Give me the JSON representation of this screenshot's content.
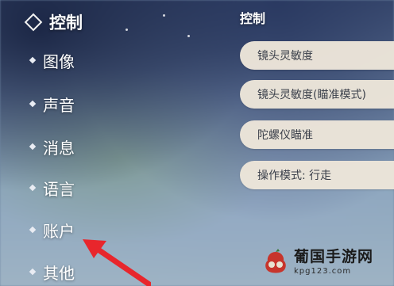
{
  "nav": {
    "title": "控制",
    "items": [
      {
        "label": "图像"
      },
      {
        "label": "声音"
      },
      {
        "label": "消息"
      },
      {
        "label": "语言"
      },
      {
        "label": "账户"
      },
      {
        "label": "其他"
      }
    ]
  },
  "panel": {
    "title": "控制",
    "rows": [
      {
        "label": "镜头灵敏度"
      },
      {
        "label": "镜头灵敏度(瞄准模式)"
      },
      {
        "label": "陀螺仪瞄准"
      },
      {
        "label": "操作模式: 行走"
      }
    ]
  },
  "watermark": {
    "title": "葡国手游网",
    "url": "kpg123.com"
  },
  "colors": {
    "arrow": "#e8262c",
    "row_bg": "#ece5d9",
    "row_text": "#3a3f4a"
  }
}
